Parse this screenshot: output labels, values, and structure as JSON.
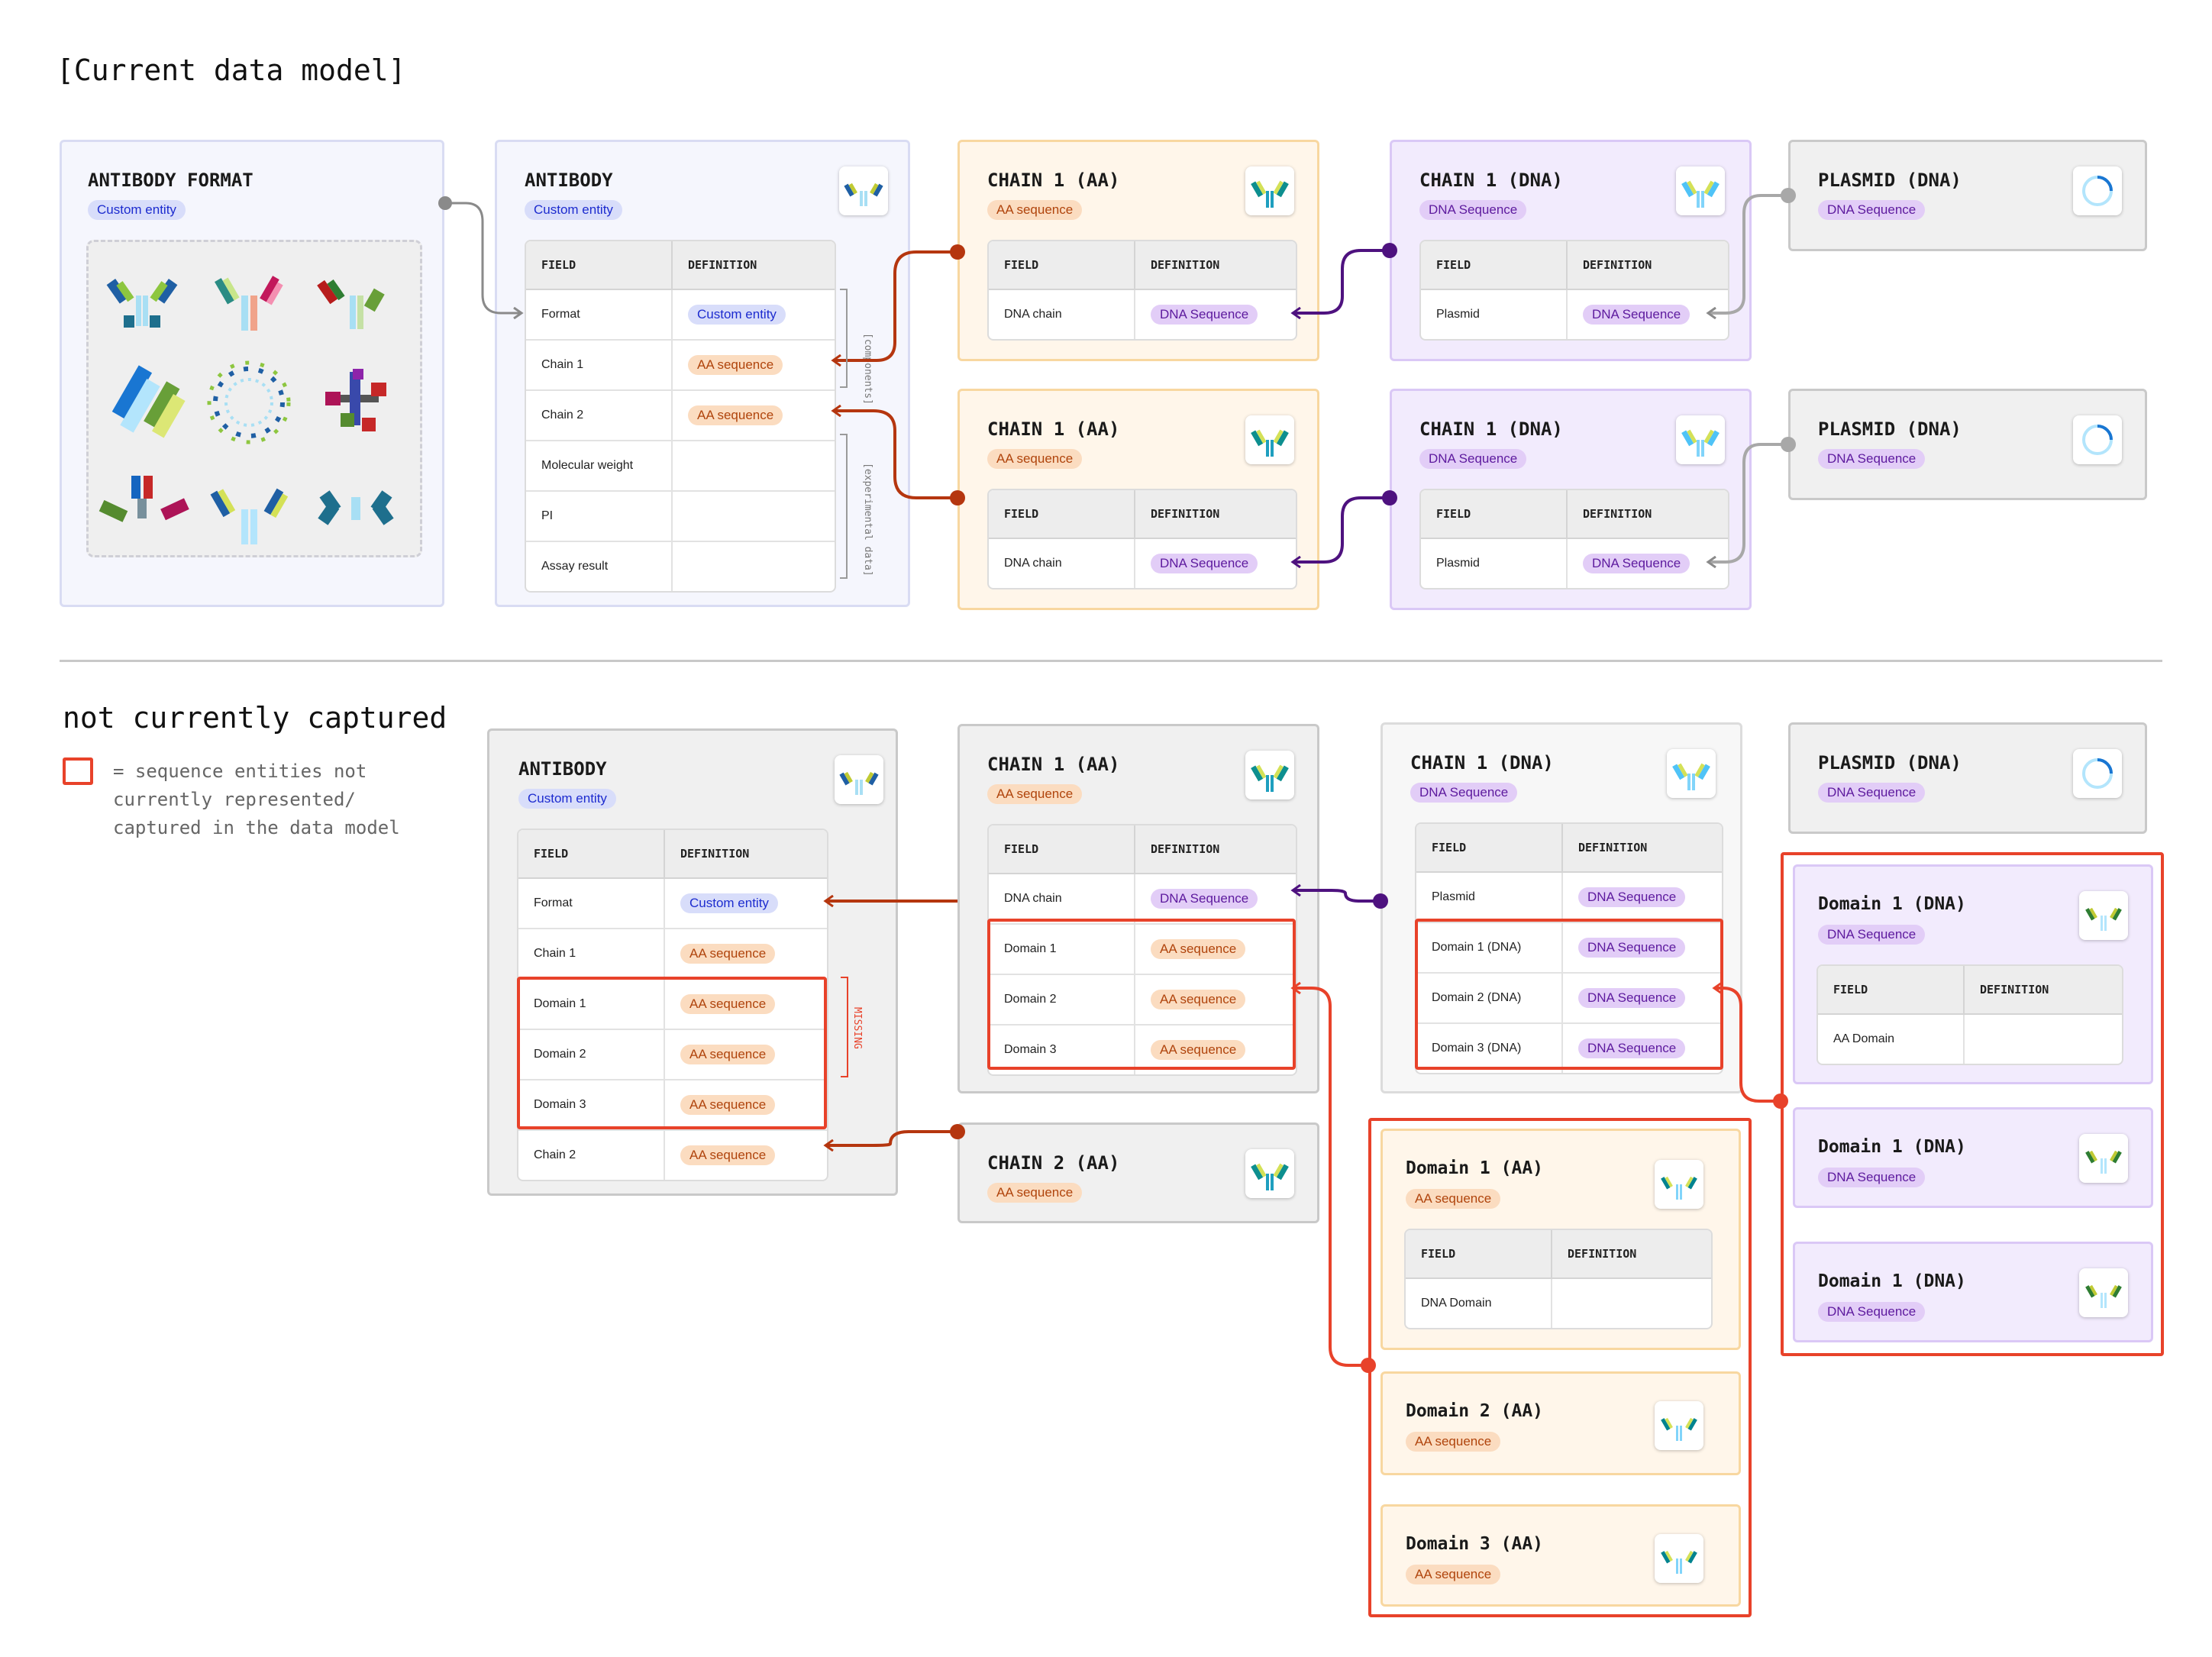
{
  "headings": {
    "current": "[Current data model]",
    "not_captured": "not currently captured",
    "legend_line1": "= sequence entities not",
    "legend_line2": "currently represented/",
    "legend_line3": "captured in the data model"
  },
  "top": {
    "antibody_format": {
      "title": "ANTIBODY FORMAT",
      "tag": "Custom entity"
    },
    "antibody": {
      "title": "ANTIBODY",
      "tag": "Custom entity",
      "field_header": "FIELD",
      "def_header": "DEFINITION",
      "rows": [
        {
          "field": "Format",
          "def": "Custom entity"
        },
        {
          "field": "Chain 1",
          "def": "AA sequence"
        },
        {
          "field": "Chain 2",
          "def": "AA sequence"
        },
        {
          "field": "Molecular weight",
          "def": ""
        },
        {
          "field": "PI",
          "def": ""
        },
        {
          "field": "Assay result",
          "def": ""
        }
      ],
      "bracket_components": "[components]",
      "bracket_experimental": "[experimental data]"
    },
    "chain_aa_1": {
      "title": "CHAIN 1 (AA)",
      "tag": "AA sequence",
      "field_header": "FIELD",
      "def_header": "DEFINITION",
      "row_field": "DNA chain",
      "row_def": "DNA Sequence"
    },
    "chain_aa_2": {
      "title": "CHAIN 1 (AA)",
      "tag": "AA sequence",
      "field_header": "FIELD",
      "def_header": "DEFINITION",
      "row_field": "DNA chain",
      "row_def": "DNA Sequence"
    },
    "chain_dna_1": {
      "title": "CHAIN 1 (DNA)",
      "tag": "DNA Sequence",
      "field_header": "FIELD",
      "def_header": "DEFINITION",
      "row_field": "Plasmid",
      "row_def": "DNA Sequence"
    },
    "chain_dna_2": {
      "title": "CHAIN 1 (DNA)",
      "tag": "DNA Sequence",
      "field_header": "FIELD",
      "def_header": "DEFINITION",
      "row_field": "Plasmid",
      "row_def": "DNA Sequence"
    },
    "plasmid_1": {
      "title": "PLASMID (DNA)",
      "tag": "DNA Sequence"
    },
    "plasmid_2": {
      "title": "PLASMID (DNA)",
      "tag": "DNA Sequence"
    }
  },
  "bottom": {
    "antibody": {
      "title": "ANTIBODY",
      "tag": "Custom entity",
      "field_header": "FIELD",
      "def_header": "DEFINITION",
      "rows": [
        {
          "field": "Format",
          "def": "Custom entity"
        },
        {
          "field": "Chain 1",
          "def": "AA sequence"
        },
        {
          "field": "Domain 1",
          "def": "AA sequence"
        },
        {
          "field": "Domain 2",
          "def": "AA sequence"
        },
        {
          "field": "Domain 3",
          "def": "AA sequence"
        },
        {
          "field": "Chain 2",
          "def": "AA sequence"
        }
      ],
      "missing_label": "MISSING"
    },
    "chain1_aa": {
      "title": "CHAIN 1 (AA)",
      "tag": "AA sequence",
      "field_header": "FIELD",
      "def_header": "DEFINITION",
      "rows": [
        {
          "field": "DNA chain",
          "def": "DNA Sequence"
        },
        {
          "field": "Domain 1",
          "def": "AA sequence"
        },
        {
          "field": "Domain 2",
          "def": "AA sequence"
        },
        {
          "field": "Domain 3",
          "def": "AA sequence"
        }
      ]
    },
    "chain1_dna": {
      "title": "CHAIN 1 (DNA)",
      "tag": "DNA Sequence",
      "field_header": "FIELD",
      "def_header": "DEFINITION",
      "rows": [
        {
          "field": "Plasmid",
          "def": "DNA Sequence"
        },
        {
          "field": "Domain 1 (DNA)",
          "def": "DNA Sequence"
        },
        {
          "field": "Domain 2 (DNA)",
          "def": "DNA Sequence"
        },
        {
          "field": "Domain 3 (DNA)",
          "def": "DNA Sequence"
        }
      ]
    },
    "plasmid": {
      "title": "PLASMID (DNA)",
      "tag": "DNA Sequence"
    },
    "chain2_aa": {
      "title": "CHAIN 2 (AA)",
      "tag": "AA sequence"
    },
    "domain1_aa": {
      "title": "Domain 1 (AA)",
      "tag": "AA sequence",
      "field_header": "FIELD",
      "def_header": "DEFINITION",
      "row_field": "DNA Domain",
      "row_def": ""
    },
    "domain2_aa": {
      "title": "Domain 2 (AA)",
      "tag": "AA sequence"
    },
    "domain3_aa": {
      "title": "Domain 3 (AA)",
      "tag": "AA sequence"
    },
    "domain1_dna_a": {
      "title": "Domain 1 (DNA)",
      "tag": "DNA Sequence",
      "field_header": "FIELD",
      "def_header": "DEFINITION",
      "row_field": "AA Domain",
      "row_def": ""
    },
    "domain1_dna_b": {
      "title": "Domain 1 (DNA)",
      "tag": "DNA Sequence"
    },
    "domain1_dna_c": {
      "title": "Domain 1 (DNA)",
      "tag": "DNA Sequence"
    }
  },
  "colors": {
    "missing_red": "#e8422a",
    "aa_arrow": "#b5360f",
    "dna_arrow": "#4e127f",
    "grey_arrow": "#8a8a8a"
  }
}
